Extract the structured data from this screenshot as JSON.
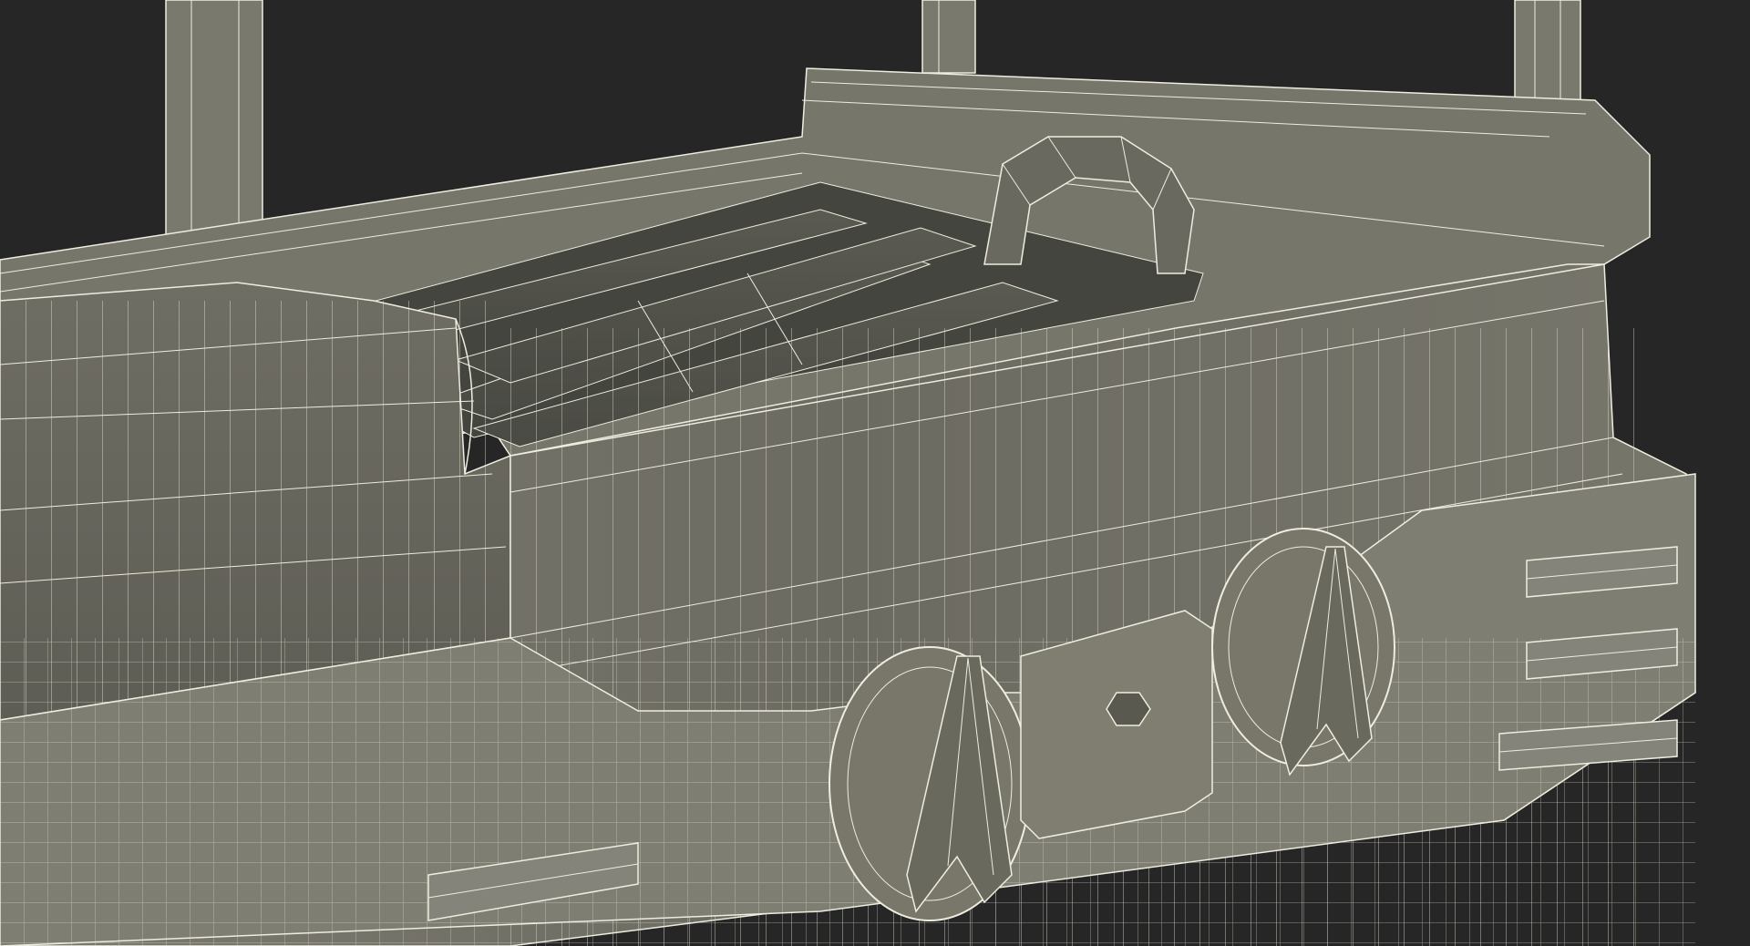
{
  "viewport": {
    "background": "#262626",
    "object": "grill-wireframe-model",
    "colors": {
      "surface_light": "#8c8b7e",
      "surface_mid": "#74736a",
      "surface_dark": "#5a5a52",
      "wire": "#f2f0e4"
    },
    "parts": [
      "left-post",
      "center-post",
      "right-post",
      "grill-body",
      "grill-rim",
      "grill-grate",
      "handle-arch",
      "control-knob-left",
      "control-knob-right",
      "igniter-button",
      "front-trim-left",
      "front-trim-right"
    ]
  }
}
